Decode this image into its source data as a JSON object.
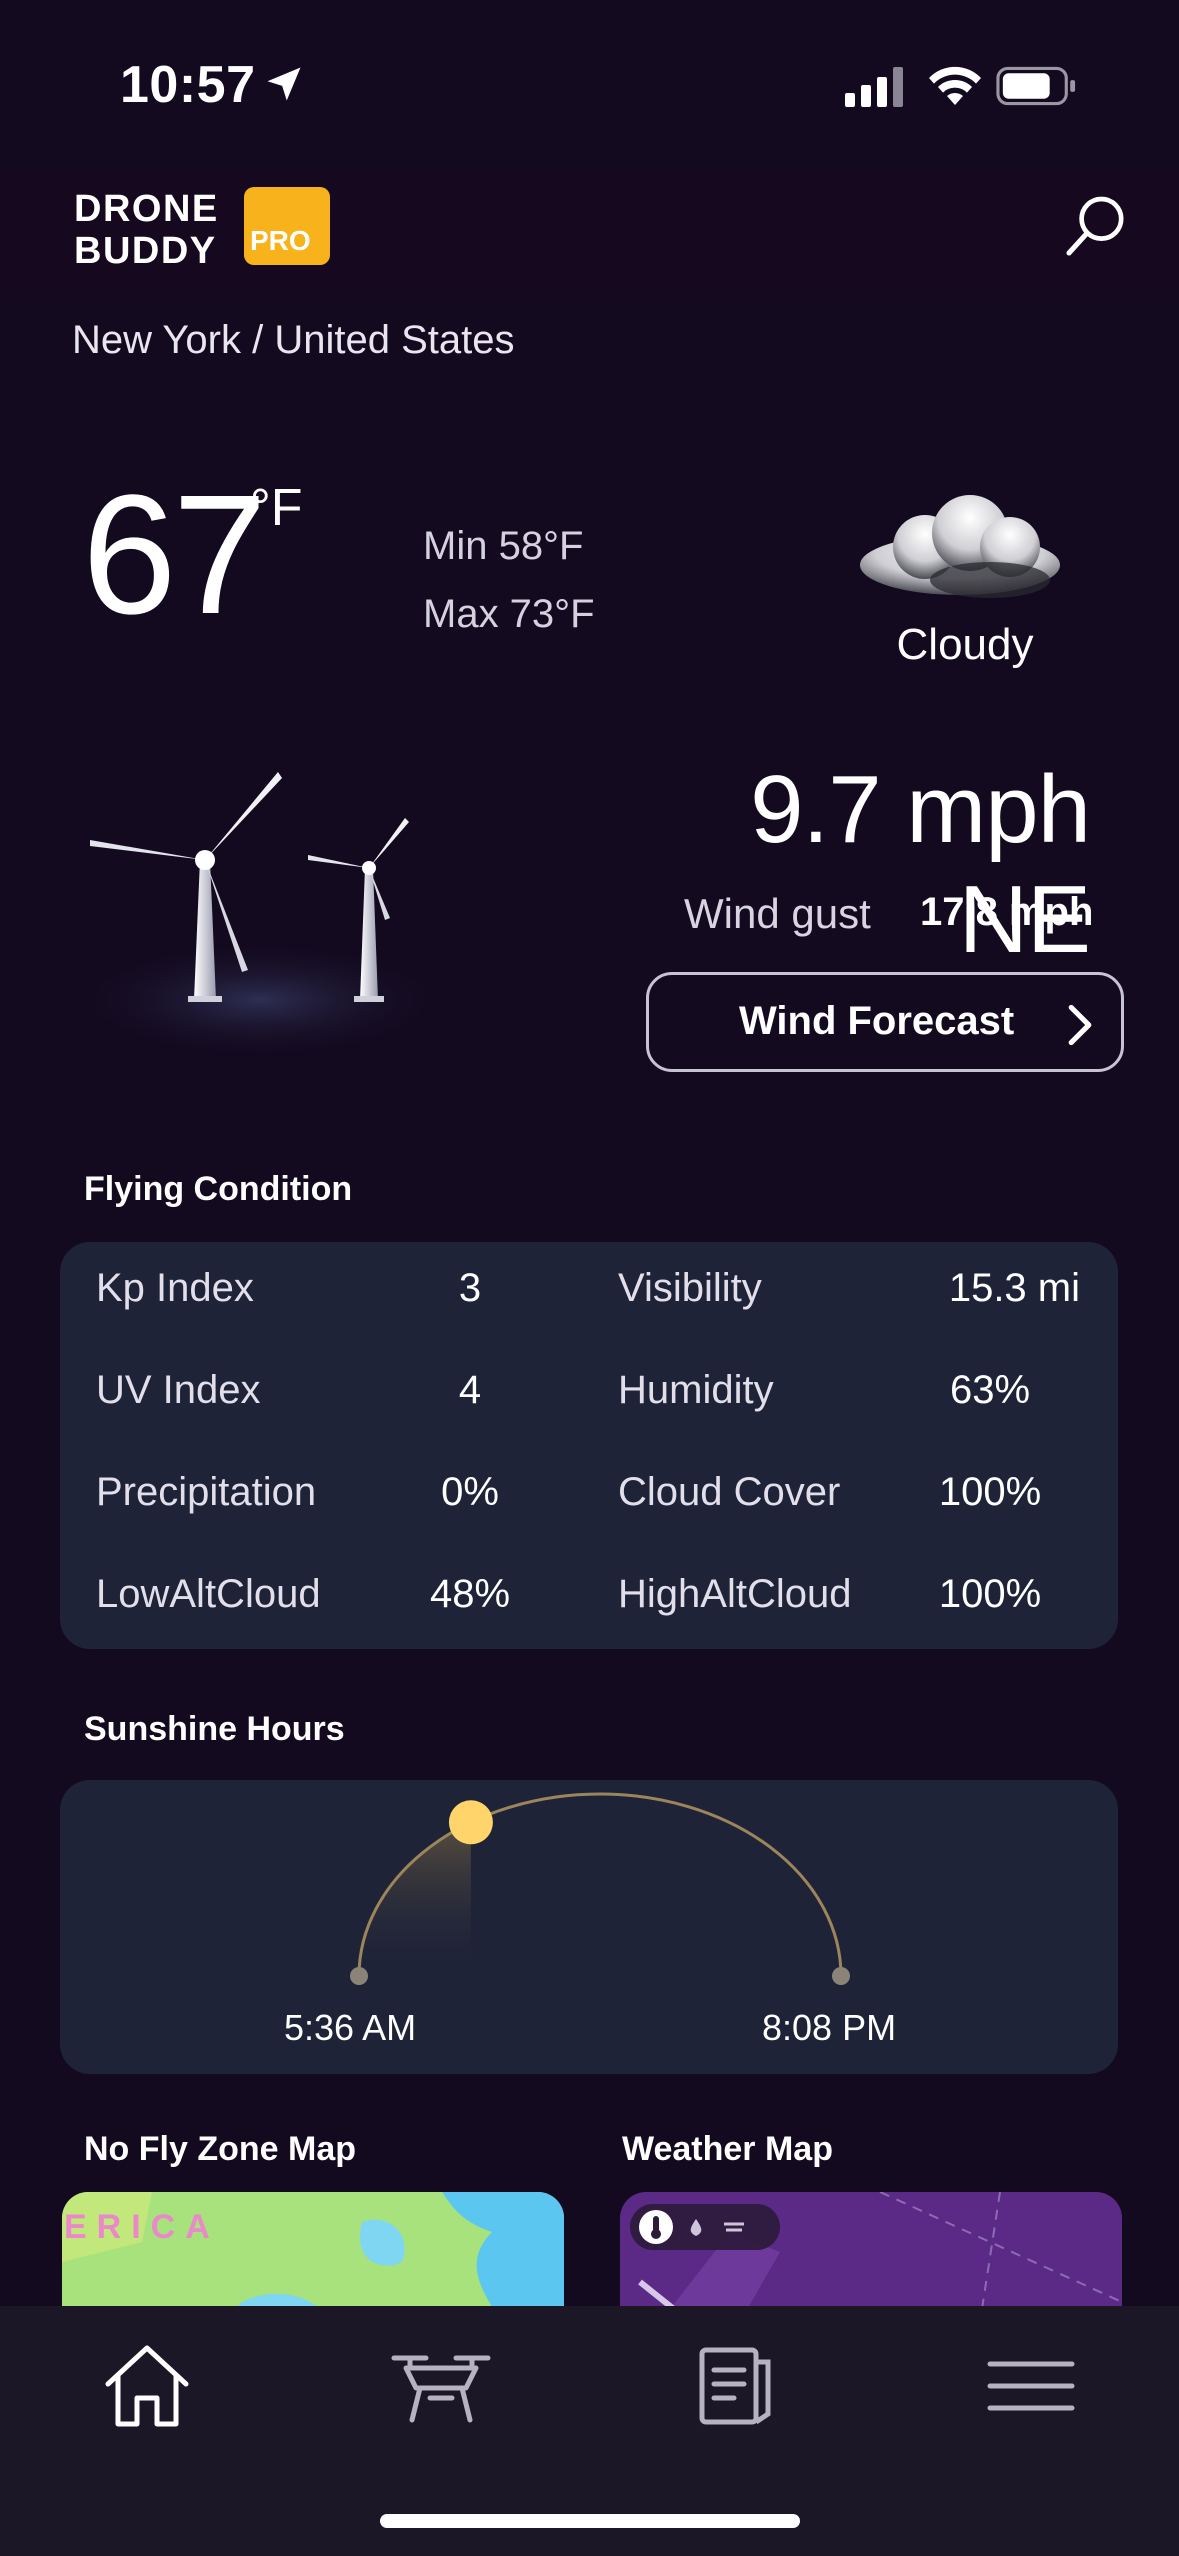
{
  "status_bar": {
    "time": "10:57",
    "icons": [
      "location-arrow-icon",
      "cellular-signal-icon",
      "wifi-icon",
      "battery-icon"
    ]
  },
  "header": {
    "logo_line1": "DRONE",
    "logo_line2": "BUDDY",
    "logo_badge": "PRO",
    "search_icon": "search-icon",
    "brand_color": "#f7b21c"
  },
  "location": "New York / United States",
  "weather": {
    "temperature": "67",
    "unit": "°F",
    "min": "Min 58°F",
    "max": "Max 73°F",
    "condition": "Cloudy",
    "condition_icon": "cloud-icon"
  },
  "wind": {
    "speed": "9.7 mph NE",
    "gust_label": "Wind gust",
    "gust_value": "17.8 mph",
    "forecast_button": "Wind Forecast",
    "icon": "wind-turbine-icon"
  },
  "flying_condition": {
    "title": "Flying Condition",
    "rows": [
      {
        "left_label": "Kp Index",
        "left_value": "3",
        "right_label": "Visibility",
        "right_value": "15.3 mi"
      },
      {
        "left_label": "UV Index",
        "left_value": "4",
        "right_label": "Humidity",
        "right_value": "63%"
      },
      {
        "left_label": "Precipitation",
        "left_value": "0%",
        "right_label": "Cloud Cover",
        "right_value": "100%"
      },
      {
        "left_label": "LowAltCloud",
        "left_value": "48%",
        "right_label": "HighAltCloud",
        "right_value": "100%"
      }
    ]
  },
  "sunshine": {
    "title": "Sunshine Hours",
    "sunrise": "5:36 AM",
    "sunset": "8:08 PM",
    "sun_color": "#ffd56b",
    "daylight_progress": 0.32
  },
  "maps": {
    "no_fly_title": "No Fly Zone Map",
    "no_fly_map_text": "ERICA",
    "weather_title": "Weather Map"
  },
  "tab_bar": {
    "items": [
      "home-icon",
      "drone-icon",
      "logbook-icon",
      "menu-icon"
    ]
  },
  "colors": {
    "background": "#130a1f",
    "card": "#1e2338",
    "tab_bar": "#1b1727"
  }
}
